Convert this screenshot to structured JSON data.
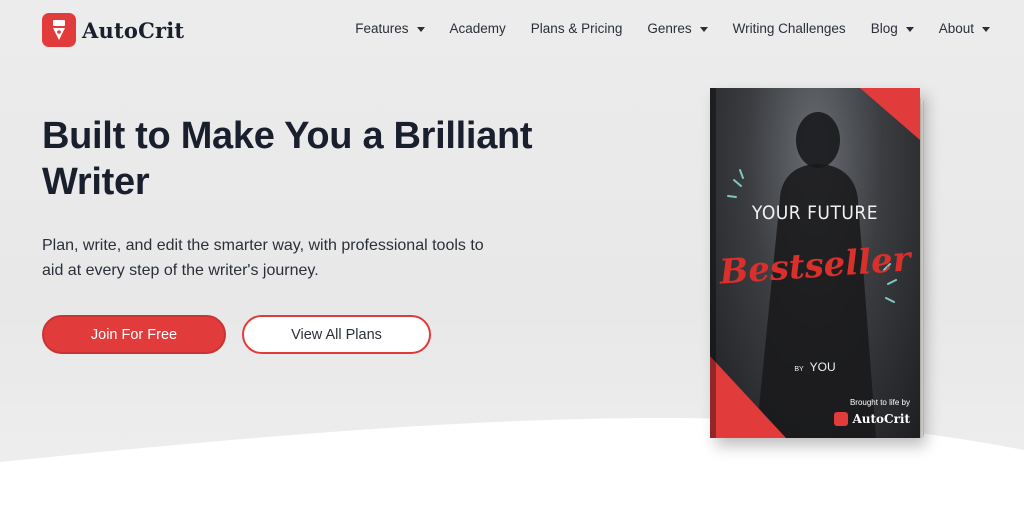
{
  "header": {
    "logo_text": "AutoCrit",
    "nav": [
      {
        "label": "Features",
        "dropdown": true
      },
      {
        "label": "Academy",
        "dropdown": false
      },
      {
        "label": "Plans & Pricing",
        "dropdown": false
      },
      {
        "label": "Genres",
        "dropdown": true
      },
      {
        "label": "Writing Challenges",
        "dropdown": false
      },
      {
        "label": "Blog",
        "dropdown": true
      },
      {
        "label": "About",
        "dropdown": true
      }
    ]
  },
  "hero": {
    "title": "Built to Make You a Brilliant Writer",
    "subtitle": "Plan, write, and edit the smarter way, with professional tools to aid at every step of the writer's journey.",
    "primary_button": "Join For Free",
    "secondary_button": "View All Plans"
  },
  "book": {
    "line1": "YOUR FUTURE",
    "line2": "Bestseller",
    "by_prefix": "BY",
    "by_name": "YOU",
    "brought": "Brought to life by",
    "brand": "AutoCrit"
  },
  "colors": {
    "accent": "#e23b3b",
    "text_dark": "#1a1f2e",
    "background": "#ececec"
  },
  "icons": {
    "logo": "pen-nib-icon",
    "dropdown": "caret-down-icon"
  }
}
